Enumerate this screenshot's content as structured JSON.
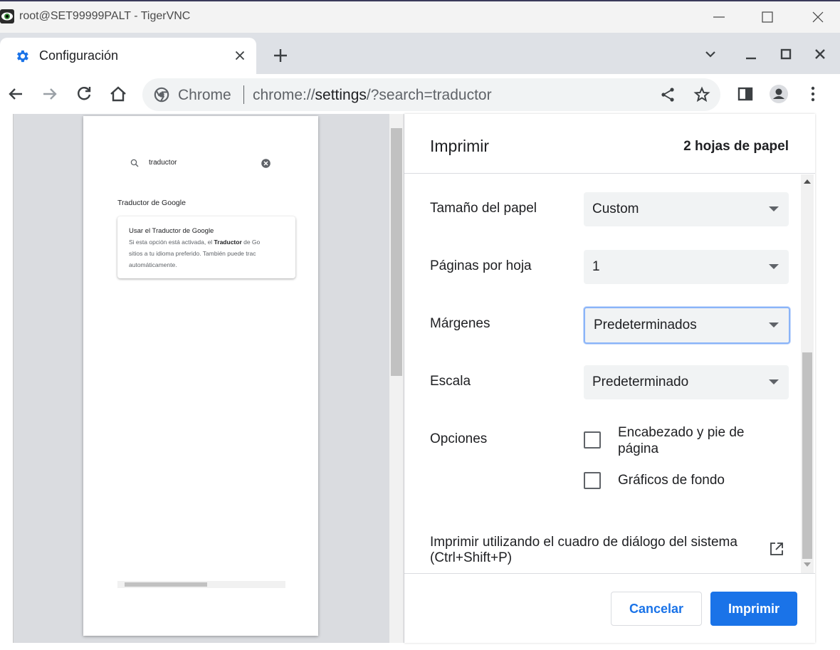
{
  "vnc": {
    "title": "root@SET99999PALT - TigerVNC",
    "icons": [
      "tigervnc-logo",
      "minimize-icon",
      "maximize-icon",
      "close-icon"
    ]
  },
  "browser": {
    "tab": {
      "title": "Configuración",
      "favicon": "gear-icon"
    },
    "omnibox": {
      "chip": "Chrome",
      "scheme": "chrome://",
      "host": "settings",
      "path": "/?search=traductor"
    }
  },
  "preview": {
    "search_text": "traductor",
    "heading": "Traductor de Google",
    "card_title": "Usar el Traductor de Google",
    "card_lines": [
      [
        "Si esta opción está activada, el ",
        "Traductor",
        " de Go"
      ],
      [
        "sitios a tu idioma preferido. También puede trac",
        "",
        ""
      ],
      [
        "automáticamente.",
        "",
        ""
      ]
    ]
  },
  "print": {
    "title": "Imprimir",
    "sheets": "2 hojas de papel",
    "paper_size": {
      "label": "Tamaño del papel",
      "value": "Custom"
    },
    "pages_per_sheet": {
      "label": "Páginas por hoja",
      "value": "1"
    },
    "margins": {
      "label": "Márgenes",
      "value": "Predeterminados"
    },
    "scale": {
      "label": "Escala",
      "value": "Predeterminado"
    },
    "options": {
      "label": "Opciones",
      "headers_footers": {
        "label_line1": "Encabezado y pie de",
        "label_line2": "página",
        "checked": false
      },
      "background_graphics": {
        "label": "Gráficos de fondo",
        "checked": false
      }
    },
    "system_dialog_line1": "Imprimir utilizando el cuadro de diálogo del sistema",
    "system_dialog_line2": "(Ctrl+Shift+P)",
    "cancel_label": "Cancelar",
    "print_label": "Imprimir"
  },
  "colors": {
    "accent": "#1a73e8",
    "focus_ring": "#8ab4f8"
  }
}
